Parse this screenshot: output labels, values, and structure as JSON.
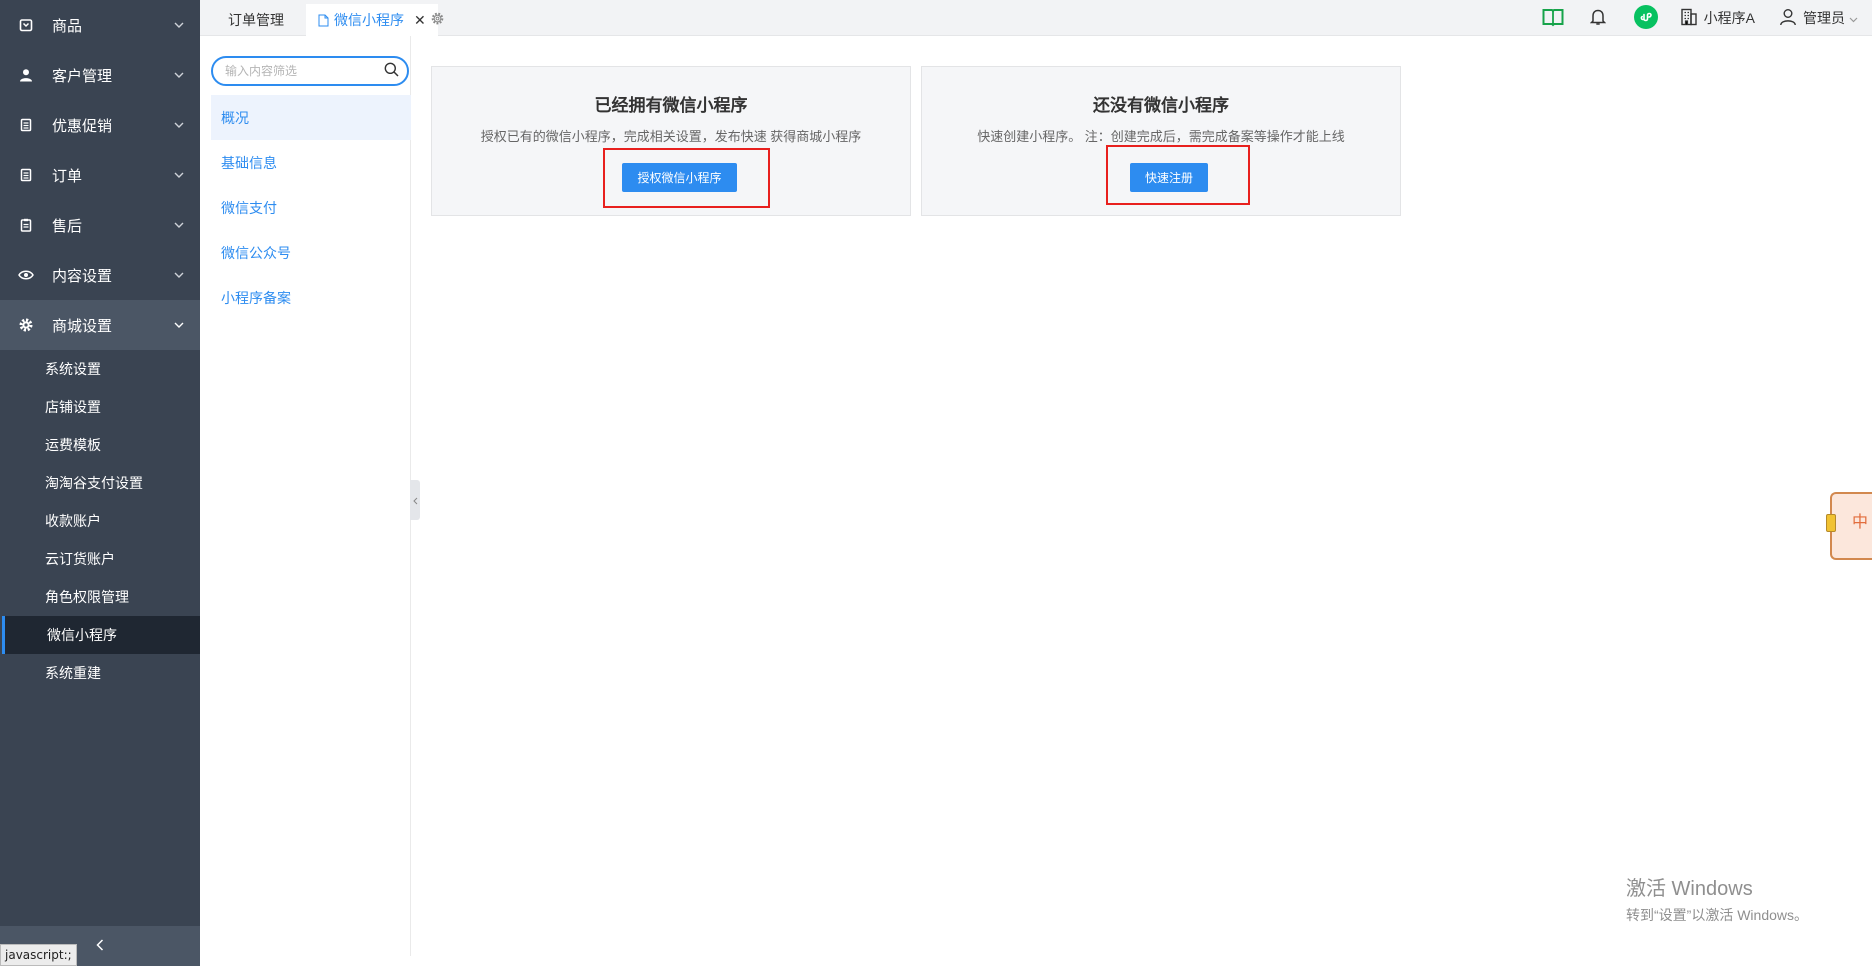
{
  "sidebar": {
    "menu": [
      {
        "label": "商品",
        "icon": "bag-icon"
      },
      {
        "label": "客户管理",
        "icon": "user-icon"
      },
      {
        "label": "优惠促销",
        "icon": "coupon-icon"
      },
      {
        "label": "订单",
        "icon": "order-icon"
      },
      {
        "label": "售后",
        "icon": "clipboard-icon"
      },
      {
        "label": "内容设置",
        "icon": "eye-icon"
      },
      {
        "label": "商城设置",
        "icon": "gear-icon"
      }
    ],
    "submenu": [
      "系统设置",
      "店铺设置",
      "运费模板",
      "淘淘谷支付设置",
      "收款账户",
      "云订货账户",
      "角色权限管理",
      "微信小程序",
      "系统重建"
    ],
    "active_submenu": "微信小程序",
    "status_tip": "javascript:;"
  },
  "tabs": [
    {
      "label": "订单管理",
      "active": false
    },
    {
      "label": "微信小程序",
      "active": true
    }
  ],
  "topbar": {
    "store_name": "小程序A",
    "user_name": "管理员"
  },
  "subnav": {
    "search_placeholder": "输入内容筛选",
    "items": [
      "概况",
      "基础信息",
      "微信支付",
      "微信公众号",
      "小程序备案"
    ],
    "active": "概况"
  },
  "cards": [
    {
      "title": "已经拥有微信小程序",
      "desc": "授权已有的微信小程序，完成相关设置，发布快速 获得商城小程序",
      "button": "授权微信小程序"
    },
    {
      "title": "还没有微信小程序",
      "desc": "快速创建小程序。 注：创建完成后，需完成备案等操作才能上线",
      "button": "快速注册"
    }
  ],
  "float_widget": {
    "char": "中"
  },
  "watermark": {
    "line1": "激活 Windows",
    "line2": "转到“设置”以激活 Windows。"
  },
  "colors": {
    "sidebar_bg": "#3a4452",
    "accent": "#2d8cf0",
    "highlight_box": "#e8201e",
    "wechat_green": "#07c160"
  }
}
